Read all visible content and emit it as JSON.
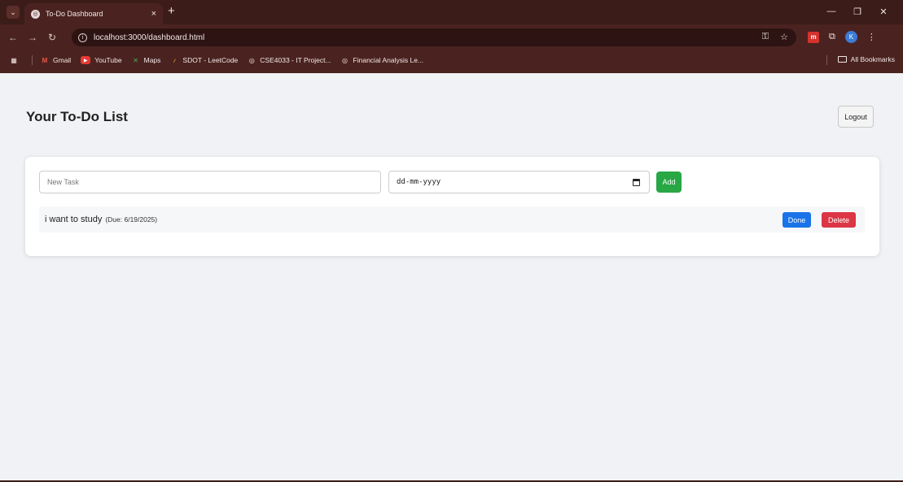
{
  "browser": {
    "tab_title": "To-Do Dashboard",
    "tab_close": "×",
    "new_tab": "+",
    "url": "localhost:3000/dashboard.html",
    "bookmarks": [
      {
        "label": "Gmail",
        "icon": "gmail-icon"
      },
      {
        "label": "YouTube",
        "icon": "youtube-icon"
      },
      {
        "label": "Maps",
        "icon": "maps-icon"
      },
      {
        "label": "SDOT - LeetCode",
        "icon": "leetcode-icon"
      },
      {
        "label": "CSE4033 - IT Project...",
        "icon": "globe-icon"
      },
      {
        "label": "Financial Analysis Le...",
        "icon": "globe-icon"
      }
    ],
    "all_bookmarks": "All Bookmarks",
    "avatar_letter": "K",
    "extension_letter": "m"
  },
  "page": {
    "heading": "Your To-Do List",
    "logout_label": "Logout",
    "new_task_placeholder": "New Task",
    "date_placeholder": "dd-mm-yyyy",
    "add_label": "Add",
    "tasks": [
      {
        "text": "i want to study",
        "due": "(Due: 6/19/2025)",
        "done_label": "Done",
        "delete_label": "Delete"
      }
    ]
  },
  "colors": {
    "chrome_bg": "#4a2320",
    "page_bg": "#f0f2f5",
    "add_button": "#28a745",
    "done_button": "#1a73e8",
    "delete_button": "#dc3545"
  }
}
